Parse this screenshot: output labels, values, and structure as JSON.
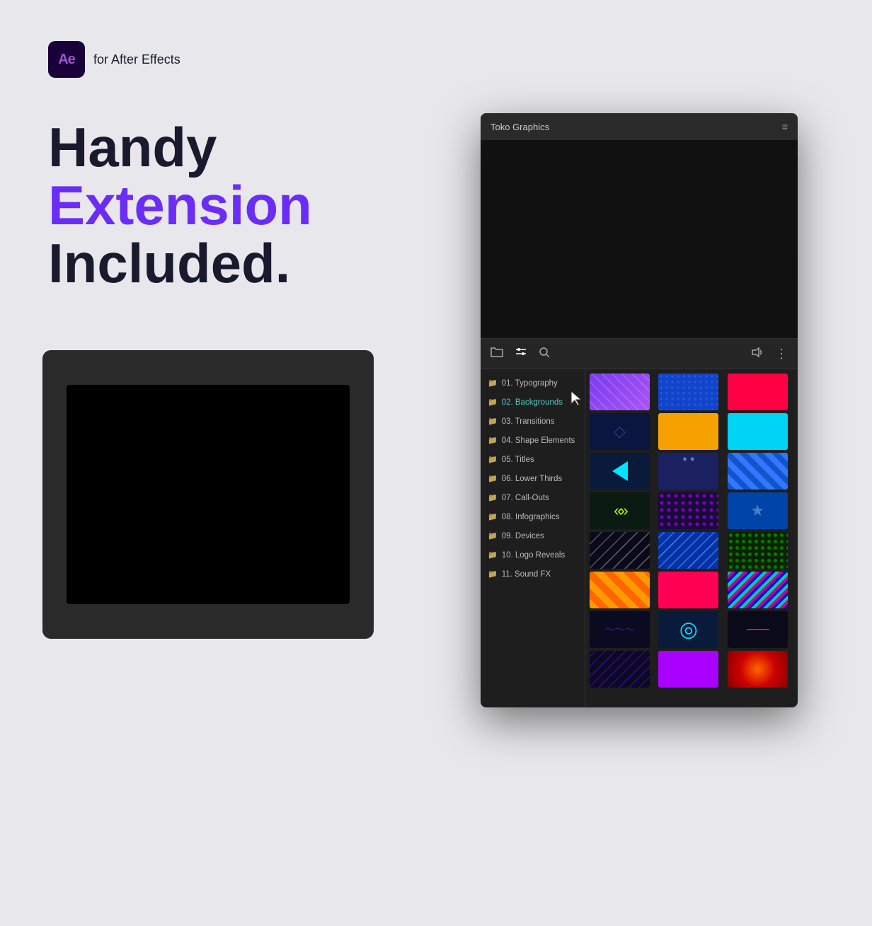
{
  "badge": {
    "ae_label": "Ae",
    "tagline": "for After Effects"
  },
  "hero": {
    "line1": "Handy",
    "line2": "Extension",
    "line3": "Included."
  },
  "panel": {
    "title": "Toko Graphics",
    "menu_icon": "≡",
    "toolbar": {
      "folder_icon": "🗂",
      "sliders_icon": "⚙",
      "search_icon": "🔍",
      "speaker_icon": "🔊",
      "more_icon": "⋮"
    },
    "list_items": [
      {
        "id": 1,
        "label": "01. Typography"
      },
      {
        "id": 2,
        "label": "02. Backgrounds",
        "active": true
      },
      {
        "id": 3,
        "label": "03. Transitions"
      },
      {
        "id": 4,
        "label": "04. Shape Elements"
      },
      {
        "id": 5,
        "label": "05. Titles"
      },
      {
        "id": 6,
        "label": "06. Lower Thirds"
      },
      {
        "id": 7,
        "label": "07. Call-Outs"
      },
      {
        "id": 8,
        "label": "08. Infographics"
      },
      {
        "id": 9,
        "label": "09. Devices"
      },
      {
        "id": 10,
        "label": "10. Logo Reveals"
      },
      {
        "id": 11,
        "label": "11. Sound FX"
      }
    ]
  }
}
